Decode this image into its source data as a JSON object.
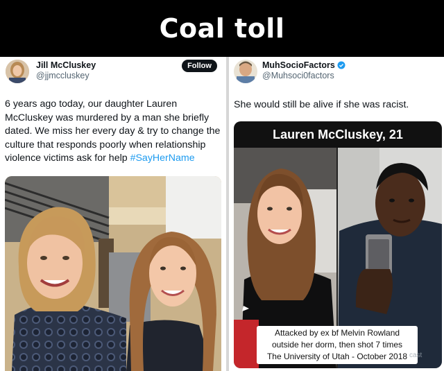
{
  "title": "Coal toll",
  "left_tweet": {
    "name": "Jill McCluskey",
    "handle": "@jjmccluskey",
    "follow_label": "Follow",
    "text_before": "6 years ago today, our daughter Lauren McCluskey was murdered by a man she briefly dated. We miss her every day & try to change the culture that responds poorly when relationship violence victims ask for help ",
    "hashtag": "#SayHerName"
  },
  "right_tweet": {
    "name": "MuhSocioFactors",
    "handle": "@Muhsoci0factors",
    "text": "She would still be alive if she was racist.",
    "card_title": "Lauren McCluskey, 21",
    "caption_line1": "Attacked by ex bf Melvin Rowland",
    "caption_line2": "outside her dorm, then shot 7 times",
    "caption_line3": "The University of Utah - October 2018",
    "watermark": "cast"
  },
  "colors": {
    "link": "#1d9bf0",
    "verified": "#1d9bf0"
  }
}
